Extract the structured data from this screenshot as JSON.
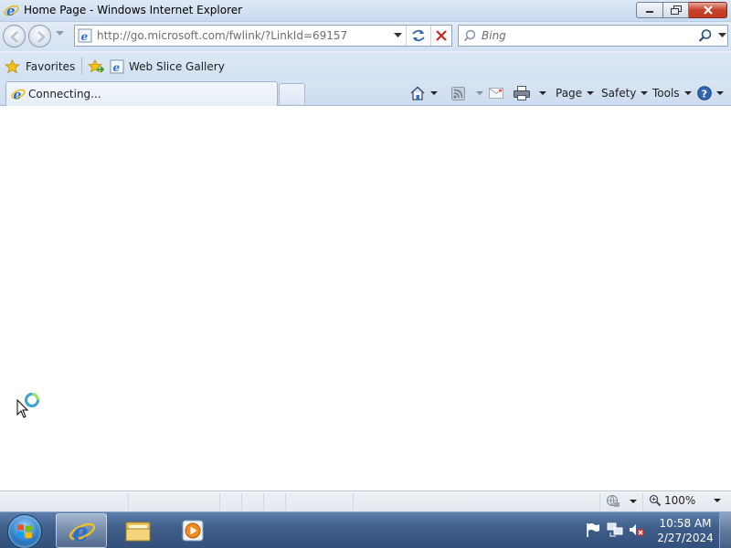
{
  "window": {
    "title": "Home Page - Windows Internet Explorer",
    "icon": "ie-icon"
  },
  "navigation": {
    "address_url": "http://go.microsoft.com/fwlink/?LinkId=69157",
    "search_placeholder": "Bing",
    "back_icon": "back-arrow-icon",
    "forward_icon": "forward-arrow-icon"
  },
  "favorites_bar": {
    "favorites_label": "Favorites",
    "items": [
      {
        "label": "Web Slice Gallery",
        "icon": "ie-icon"
      }
    ]
  },
  "tabs": [
    {
      "label": "Connecting...",
      "active": true
    }
  ],
  "command_bar": {
    "page_label": "Page",
    "safety_label": "Safety",
    "tools_label": "Tools"
  },
  "status_bar": {
    "zoom": "100%"
  },
  "taskbar": {
    "pinned": [
      {
        "name": "internet-explorer",
        "active": true
      },
      {
        "name": "windows-explorer",
        "active": false
      },
      {
        "name": "media-player",
        "active": false
      }
    ],
    "clock_time": "10:58 AM",
    "clock_date": "2/27/2024"
  },
  "colors": {
    "chrome_blue": "#d5e2f2",
    "taskbar_blue": "#3e5d89",
    "close_red": "#c7412a",
    "ie_blue": "#2a6fc9",
    "favorites_star": "#f2c21a"
  }
}
